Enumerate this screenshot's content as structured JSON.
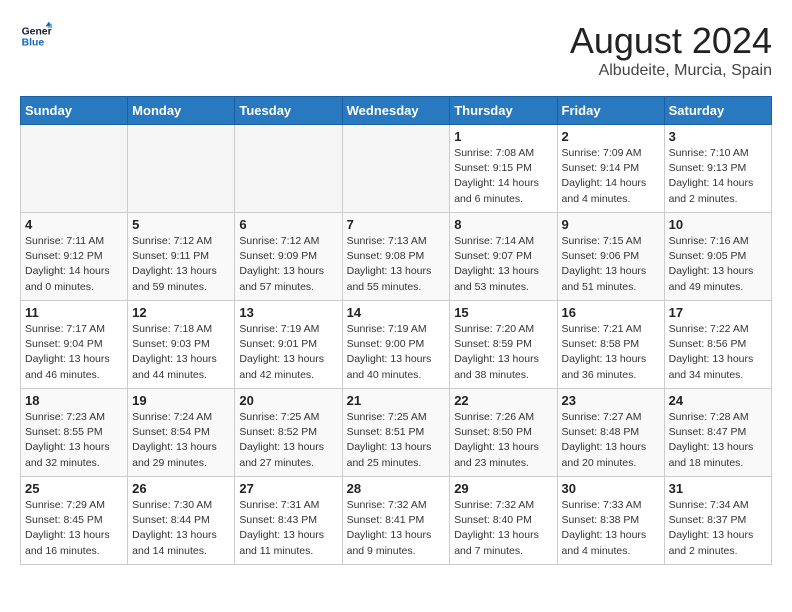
{
  "header": {
    "logo_line1": "General",
    "logo_line2": "Blue",
    "main_title": "August 2024",
    "subtitle": "Albudeite, Murcia, Spain"
  },
  "weekdays": [
    "Sunday",
    "Monday",
    "Tuesday",
    "Wednesday",
    "Thursday",
    "Friday",
    "Saturday"
  ],
  "weeks": [
    [
      {
        "day": "",
        "info": ""
      },
      {
        "day": "",
        "info": ""
      },
      {
        "day": "",
        "info": ""
      },
      {
        "day": "",
        "info": ""
      },
      {
        "day": "1",
        "info": "Sunrise: 7:08 AM\nSunset: 9:15 PM\nDaylight: 14 hours\nand 6 minutes."
      },
      {
        "day": "2",
        "info": "Sunrise: 7:09 AM\nSunset: 9:14 PM\nDaylight: 14 hours\nand 4 minutes."
      },
      {
        "day": "3",
        "info": "Sunrise: 7:10 AM\nSunset: 9:13 PM\nDaylight: 14 hours\nand 2 minutes."
      }
    ],
    [
      {
        "day": "4",
        "info": "Sunrise: 7:11 AM\nSunset: 9:12 PM\nDaylight: 14 hours\nand 0 minutes."
      },
      {
        "day": "5",
        "info": "Sunrise: 7:12 AM\nSunset: 9:11 PM\nDaylight: 13 hours\nand 59 minutes."
      },
      {
        "day": "6",
        "info": "Sunrise: 7:12 AM\nSunset: 9:09 PM\nDaylight: 13 hours\nand 57 minutes."
      },
      {
        "day": "7",
        "info": "Sunrise: 7:13 AM\nSunset: 9:08 PM\nDaylight: 13 hours\nand 55 minutes."
      },
      {
        "day": "8",
        "info": "Sunrise: 7:14 AM\nSunset: 9:07 PM\nDaylight: 13 hours\nand 53 minutes."
      },
      {
        "day": "9",
        "info": "Sunrise: 7:15 AM\nSunset: 9:06 PM\nDaylight: 13 hours\nand 51 minutes."
      },
      {
        "day": "10",
        "info": "Sunrise: 7:16 AM\nSunset: 9:05 PM\nDaylight: 13 hours\nand 49 minutes."
      }
    ],
    [
      {
        "day": "11",
        "info": "Sunrise: 7:17 AM\nSunset: 9:04 PM\nDaylight: 13 hours\nand 46 minutes."
      },
      {
        "day": "12",
        "info": "Sunrise: 7:18 AM\nSunset: 9:03 PM\nDaylight: 13 hours\nand 44 minutes."
      },
      {
        "day": "13",
        "info": "Sunrise: 7:19 AM\nSunset: 9:01 PM\nDaylight: 13 hours\nand 42 minutes."
      },
      {
        "day": "14",
        "info": "Sunrise: 7:19 AM\nSunset: 9:00 PM\nDaylight: 13 hours\nand 40 minutes."
      },
      {
        "day": "15",
        "info": "Sunrise: 7:20 AM\nSunset: 8:59 PM\nDaylight: 13 hours\nand 38 minutes."
      },
      {
        "day": "16",
        "info": "Sunrise: 7:21 AM\nSunset: 8:58 PM\nDaylight: 13 hours\nand 36 minutes."
      },
      {
        "day": "17",
        "info": "Sunrise: 7:22 AM\nSunset: 8:56 PM\nDaylight: 13 hours\nand 34 minutes."
      }
    ],
    [
      {
        "day": "18",
        "info": "Sunrise: 7:23 AM\nSunset: 8:55 PM\nDaylight: 13 hours\nand 32 minutes."
      },
      {
        "day": "19",
        "info": "Sunrise: 7:24 AM\nSunset: 8:54 PM\nDaylight: 13 hours\nand 29 minutes."
      },
      {
        "day": "20",
        "info": "Sunrise: 7:25 AM\nSunset: 8:52 PM\nDaylight: 13 hours\nand 27 minutes."
      },
      {
        "day": "21",
        "info": "Sunrise: 7:25 AM\nSunset: 8:51 PM\nDaylight: 13 hours\nand 25 minutes."
      },
      {
        "day": "22",
        "info": "Sunrise: 7:26 AM\nSunset: 8:50 PM\nDaylight: 13 hours\nand 23 minutes."
      },
      {
        "day": "23",
        "info": "Sunrise: 7:27 AM\nSunset: 8:48 PM\nDaylight: 13 hours\nand 20 minutes."
      },
      {
        "day": "24",
        "info": "Sunrise: 7:28 AM\nSunset: 8:47 PM\nDaylight: 13 hours\nand 18 minutes."
      }
    ],
    [
      {
        "day": "25",
        "info": "Sunrise: 7:29 AM\nSunset: 8:45 PM\nDaylight: 13 hours\nand 16 minutes."
      },
      {
        "day": "26",
        "info": "Sunrise: 7:30 AM\nSunset: 8:44 PM\nDaylight: 13 hours\nand 14 minutes."
      },
      {
        "day": "27",
        "info": "Sunrise: 7:31 AM\nSunset: 8:43 PM\nDaylight: 13 hours\nand 11 minutes."
      },
      {
        "day": "28",
        "info": "Sunrise: 7:32 AM\nSunset: 8:41 PM\nDaylight: 13 hours\nand 9 minutes."
      },
      {
        "day": "29",
        "info": "Sunrise: 7:32 AM\nSunset: 8:40 PM\nDaylight: 13 hours\nand 7 minutes."
      },
      {
        "day": "30",
        "info": "Sunrise: 7:33 AM\nSunset: 8:38 PM\nDaylight: 13 hours\nand 4 minutes."
      },
      {
        "day": "31",
        "info": "Sunrise: 7:34 AM\nSunset: 8:37 PM\nDaylight: 13 hours\nand 2 minutes."
      }
    ]
  ]
}
